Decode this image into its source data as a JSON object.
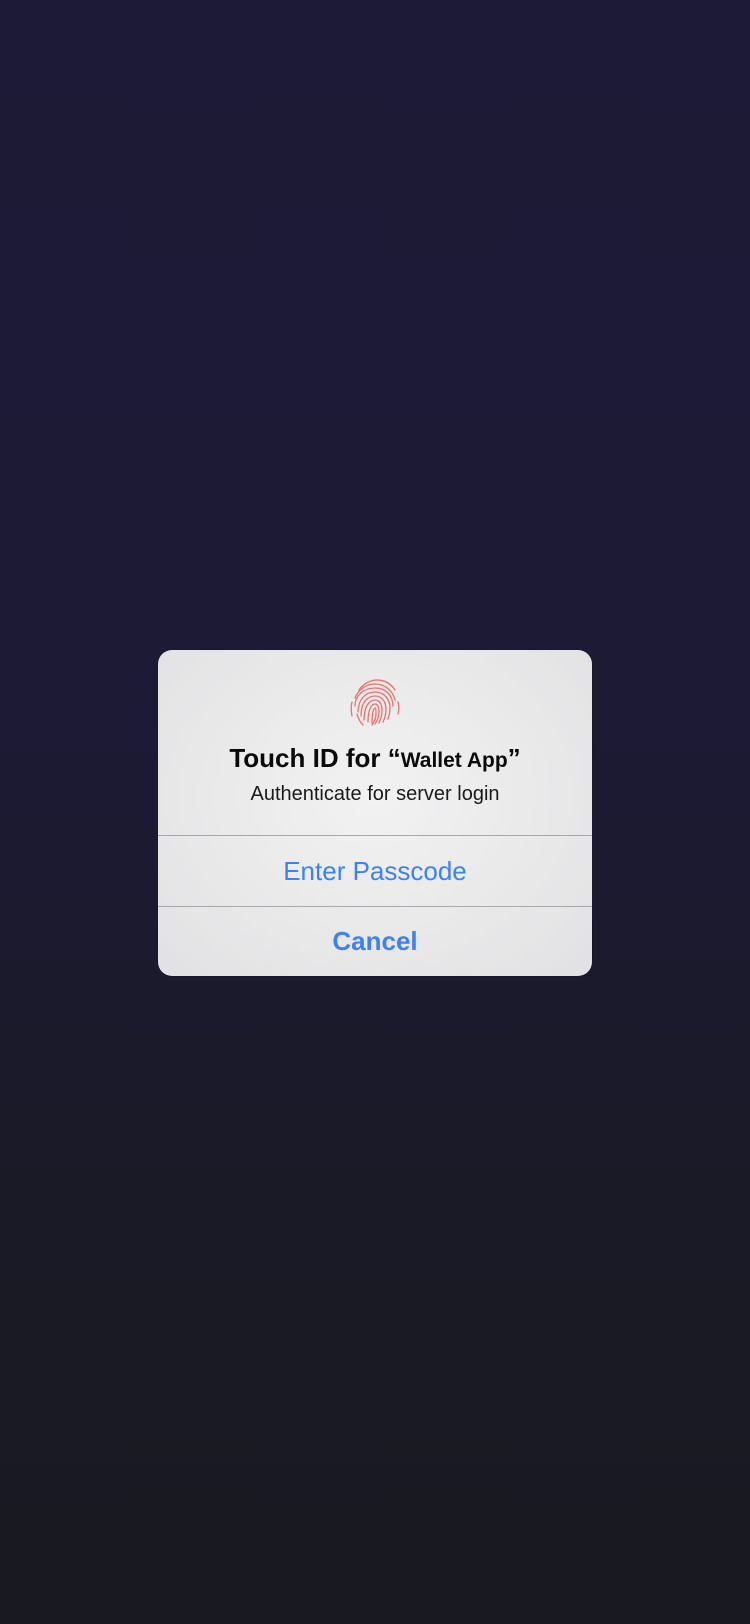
{
  "alert": {
    "icon": "fingerprint-icon",
    "title_prefix": "Touch ID for “",
    "app_name": "Wallet App",
    "title_suffix": "”",
    "message": "Authenticate for server login",
    "buttons": {
      "enter_passcode": "Enter Passcode",
      "cancel": "Cancel"
    }
  },
  "colors": {
    "background_top": "#1d1a37",
    "background_bottom": "#191921",
    "alert_background": "#ececed",
    "button_text": "#3c82f0",
    "fingerprint": "#ec6f6a",
    "divider": "#a9a9ad"
  }
}
